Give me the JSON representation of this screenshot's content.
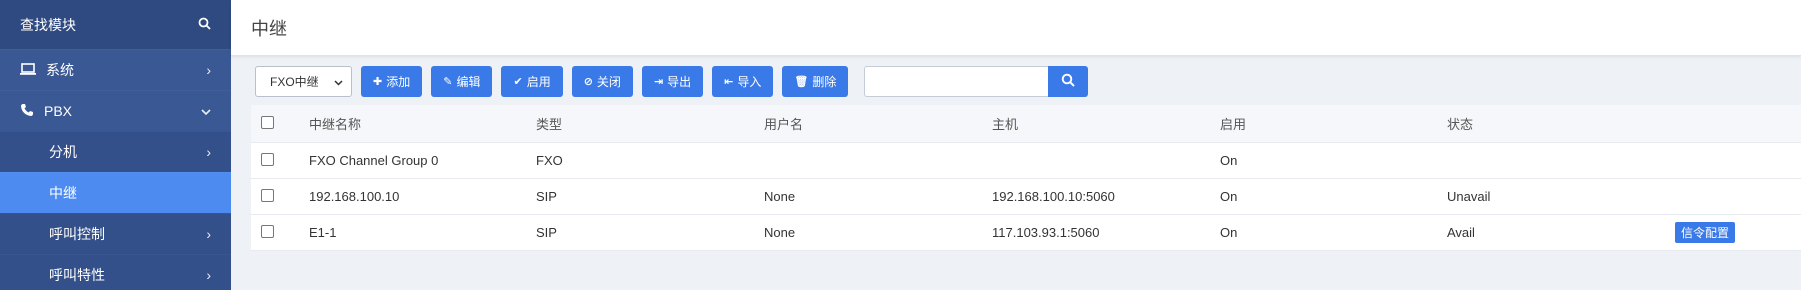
{
  "sidebar": {
    "search_label": "查找模块",
    "items": [
      {
        "label": "系统",
        "icon": "laptop-icon"
      },
      {
        "label": "PBX",
        "icon": "phone-icon"
      },
      {
        "label": "分机"
      },
      {
        "label": "中继"
      },
      {
        "label": "呼叫控制"
      },
      {
        "label": "呼叫特性"
      }
    ]
  },
  "header": {
    "title": "中继"
  },
  "toolbar": {
    "select_value": "FXO中继",
    "buttons": {
      "add": "添加",
      "edit": "编辑",
      "enable": "启用",
      "close": "关闭",
      "export": "导出",
      "import": "导入",
      "delete": "删除"
    },
    "search_placeholder": ""
  },
  "table": {
    "headers": {
      "name": "中继名称",
      "type": "类型",
      "user": "用户名",
      "host": "主机",
      "enabled": "启用",
      "status": "状态"
    },
    "rows": [
      {
        "name": "FXO Channel Group 0",
        "type": "FXO",
        "user": "",
        "host": "",
        "enabled": "On",
        "status": "",
        "action": ""
      },
      {
        "name": "192.168.100.10",
        "type": "SIP",
        "user": "None",
        "host": "192.168.100.10:5060",
        "enabled": "On",
        "status": "Unavail",
        "action": ""
      },
      {
        "name": "E1-1",
        "type": "SIP",
        "user": "None",
        "host": "117.103.93.1:5060",
        "enabled": "On",
        "status": "Avail",
        "action": "信令配置"
      }
    ]
  },
  "colors": {
    "sidebar_bg": "#2f4a80",
    "sidebar_active": "#4d8bf0",
    "button_blue": "#3a7ae8"
  }
}
